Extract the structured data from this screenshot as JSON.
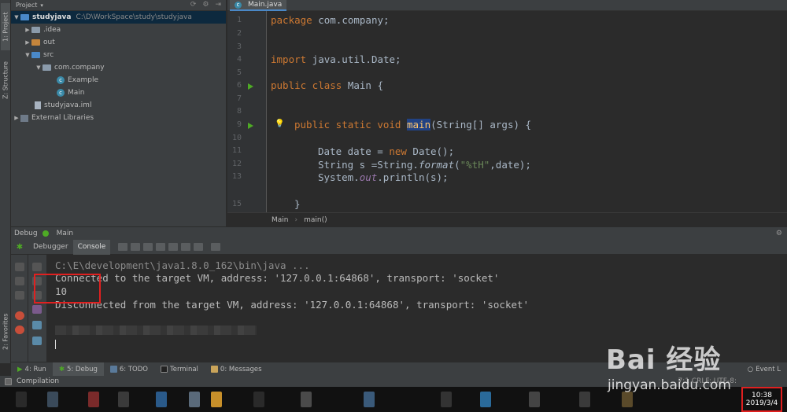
{
  "left_stripe": {
    "project_tab": "1: Project",
    "structure_tab": "Z: Structure",
    "favorites_tab": "2: Favorites"
  },
  "project": {
    "header": "Project",
    "tree": [
      {
        "label": "studyjava",
        "hint": "C:\\D\\WorkSpace\\study\\studyjava",
        "bold": true
      },
      {
        "label": ".idea"
      },
      {
        "label": "out"
      },
      {
        "label": "src"
      },
      {
        "label": "com.company"
      },
      {
        "label": "Example"
      },
      {
        "label": "Main"
      },
      {
        "label": "studyjava.iml"
      },
      {
        "label": "External Libraries"
      }
    ]
  },
  "editor": {
    "tab": "Main.java",
    "line_numbers": [
      "1",
      "2",
      "3",
      "4",
      "5",
      "6",
      "7",
      "8",
      "9",
      "10",
      "11",
      "12",
      "13",
      "15"
    ],
    "code": {
      "l1_kw": "package",
      "l1_rest": " com.company;",
      "l4_kw": "import",
      "l4_rest": " java.util.Date;",
      "l6_kw": "public class",
      "l6_rest": " Main {",
      "l9_kw": "public static void ",
      "l9_fn": "main",
      "l9_rest": "(String[] args) {",
      "l11_a": "Date date = ",
      "l11_kw": "new",
      "l11_b": " Date();",
      "l12_a": "String s =String.",
      "l12_it": "format",
      "l12_b": "(",
      "l12_str": "\"%tH\"",
      "l12_c": ",date);",
      "l13_a": "System.",
      "l13_st": "out",
      "l13_b": ".println(s);",
      "l15": "}"
    },
    "breadcrumb": [
      "Main",
      "main()"
    ]
  },
  "debug": {
    "bar_title": "Debug",
    "bar_config": "Main",
    "tabs": [
      "Debugger",
      "Console"
    ],
    "console": {
      "cmd": "C:\\E\\development\\java1.8.0_162\\bin\\java ...",
      "line1": "Connected to the target VM, address: '127.0.0.1:64868', transport: 'socket'",
      "line2": "10",
      "line3": "Disconnected from the target VM, address: '127.0.0.1:64868', transport: 'socket'"
    }
  },
  "tool_tabs": [
    "4: Run",
    "5: Debug",
    "6: TODO",
    "Terminal",
    "0: Messages"
  ],
  "event_log": "Event L",
  "status": {
    "text": "Compilation",
    "right": "7:1  CRLF:  UTF-8:"
  },
  "clock": {
    "time": "10:38",
    "date": "2019/3/4"
  },
  "watermark": {
    "logo": "Bai 经验",
    "url": "jingyan.baidu.com"
  }
}
